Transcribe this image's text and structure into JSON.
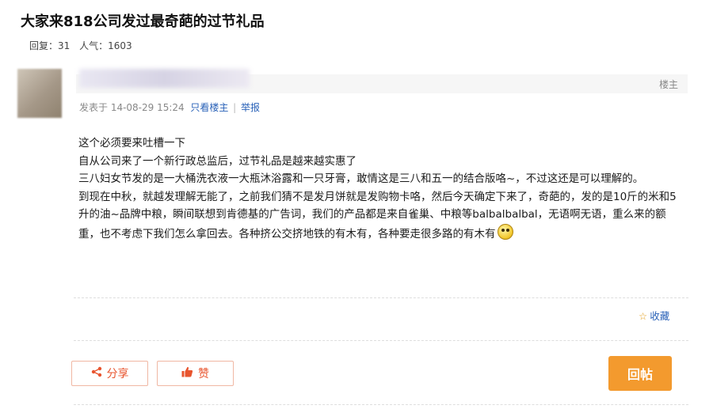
{
  "thread": {
    "title": "大家来818公司发过最奇葩的过节礼品",
    "reply_label": "回复：31",
    "views_label": "人气：1603"
  },
  "post": {
    "floor_label": "楼主",
    "posted_label": "发表于 14-08-29 15:24",
    "only_author_label": "只看楼主",
    "separator": "|",
    "report_label": "举报",
    "paragraphs": [
      "这个必须要来吐槽一下",
      "自从公司来了一个新行政总监后，过节礼品是越来越实惠了",
      "三八妇女节发的是一大桶洗衣液一大瓶沐浴露和一只牙膏，敢情这是三八和五一的结合版咯~，不过这还是可以理解的。",
      "到现在中秋，就越发理解无能了，之前我们猜不是发月饼就是发购物卡咯，然后今天确定下来了，奇葩的，发的是10斤的米和5升的油~品牌中粮，瞬间联想到肯德基的广告词，我们的产品都是来自雀巢、中粮等balbalbalbal，无语啊无语，重么来的额重，也不考虑下我们怎么拿回去。各种挤公交挤地铁的有木有，各种要走很多路的有木有"
    ],
    "emoji_icon": "smiley-sweat-icon",
    "collect_label": "收藏"
  },
  "actions": {
    "share_label": "分享",
    "like_label": "赞",
    "reply_button_label": "回帖",
    "share_icon": "share-icon",
    "like_icon": "thumbs-up-icon"
  },
  "colors": {
    "link": "#2a62b8",
    "accent_orange": "#f39a2e",
    "ghost_text": "#e8542e"
  }
}
